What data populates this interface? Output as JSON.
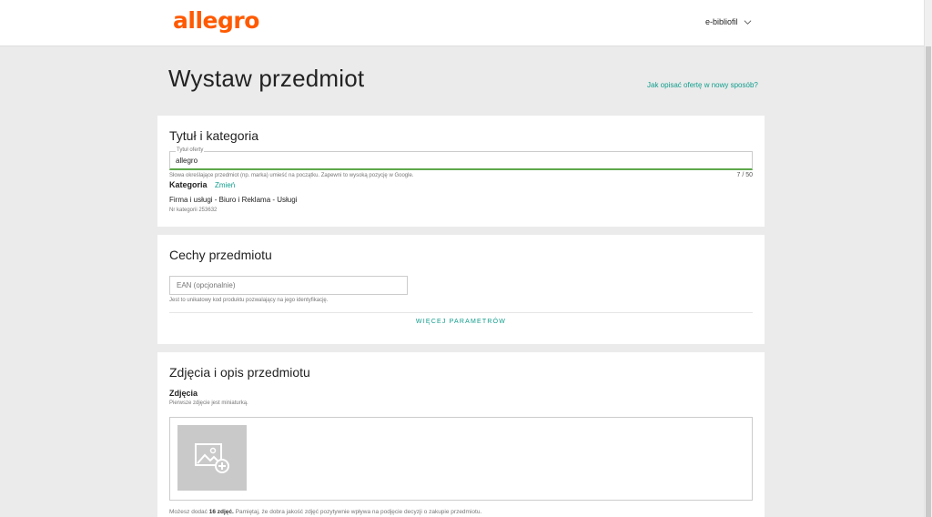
{
  "header": {
    "logo": "allegro",
    "user_name": "e-bibliofil"
  },
  "page": {
    "title": "Wystaw przedmiot",
    "help_link": "Jak opisać ofertę w nowy sposób?"
  },
  "section_title": {
    "heading": "Tytuł i kategoria",
    "title_field": {
      "label": "Tytuł oferty",
      "value": "allegro"
    },
    "title_hint": "Słowa określające przedmiot (np. marka) umieść na początku. Zapewni to wysoką pozycję w Google.",
    "counter": "7 / 50",
    "category_label": "Kategoria",
    "category_change": "Zmień",
    "category_path": "Firma i usługi - Biuro i Reklama - Usługi",
    "category_number": "Nr kategorii 253632"
  },
  "section_features": {
    "heading": "Cechy przedmiotu",
    "ean_placeholder": "EAN (opcjonalnie)",
    "ean_hint": "Jest to unikatowy kod produktu pozwalający na jego identyfikację.",
    "more_params": "WIĘCEJ PARAMETRÓW"
  },
  "section_photos": {
    "heading": "Zdjęcia i opis przedmiotu",
    "photos_label": "Zdjęcia",
    "photos_hint": "Pierwsze zdjęcie jest miniaturką.",
    "note_prefix": "Możesz dodać ",
    "note_bold": "16 zdjęć.",
    "note_suffix": " Pamiętaj, że dobra jakość zdjęć pozytywnie wpływa na podjęcie decyzji o zakupie przedmiotu."
  },
  "colors": {
    "brand": "#ff5a00",
    "link": "#0f9d8c",
    "input_focus": "#5fa84b",
    "background": "#ebebeb"
  },
  "icons": {
    "user_menu": "chevron-down-icon",
    "add_photo": "add-image-icon"
  }
}
